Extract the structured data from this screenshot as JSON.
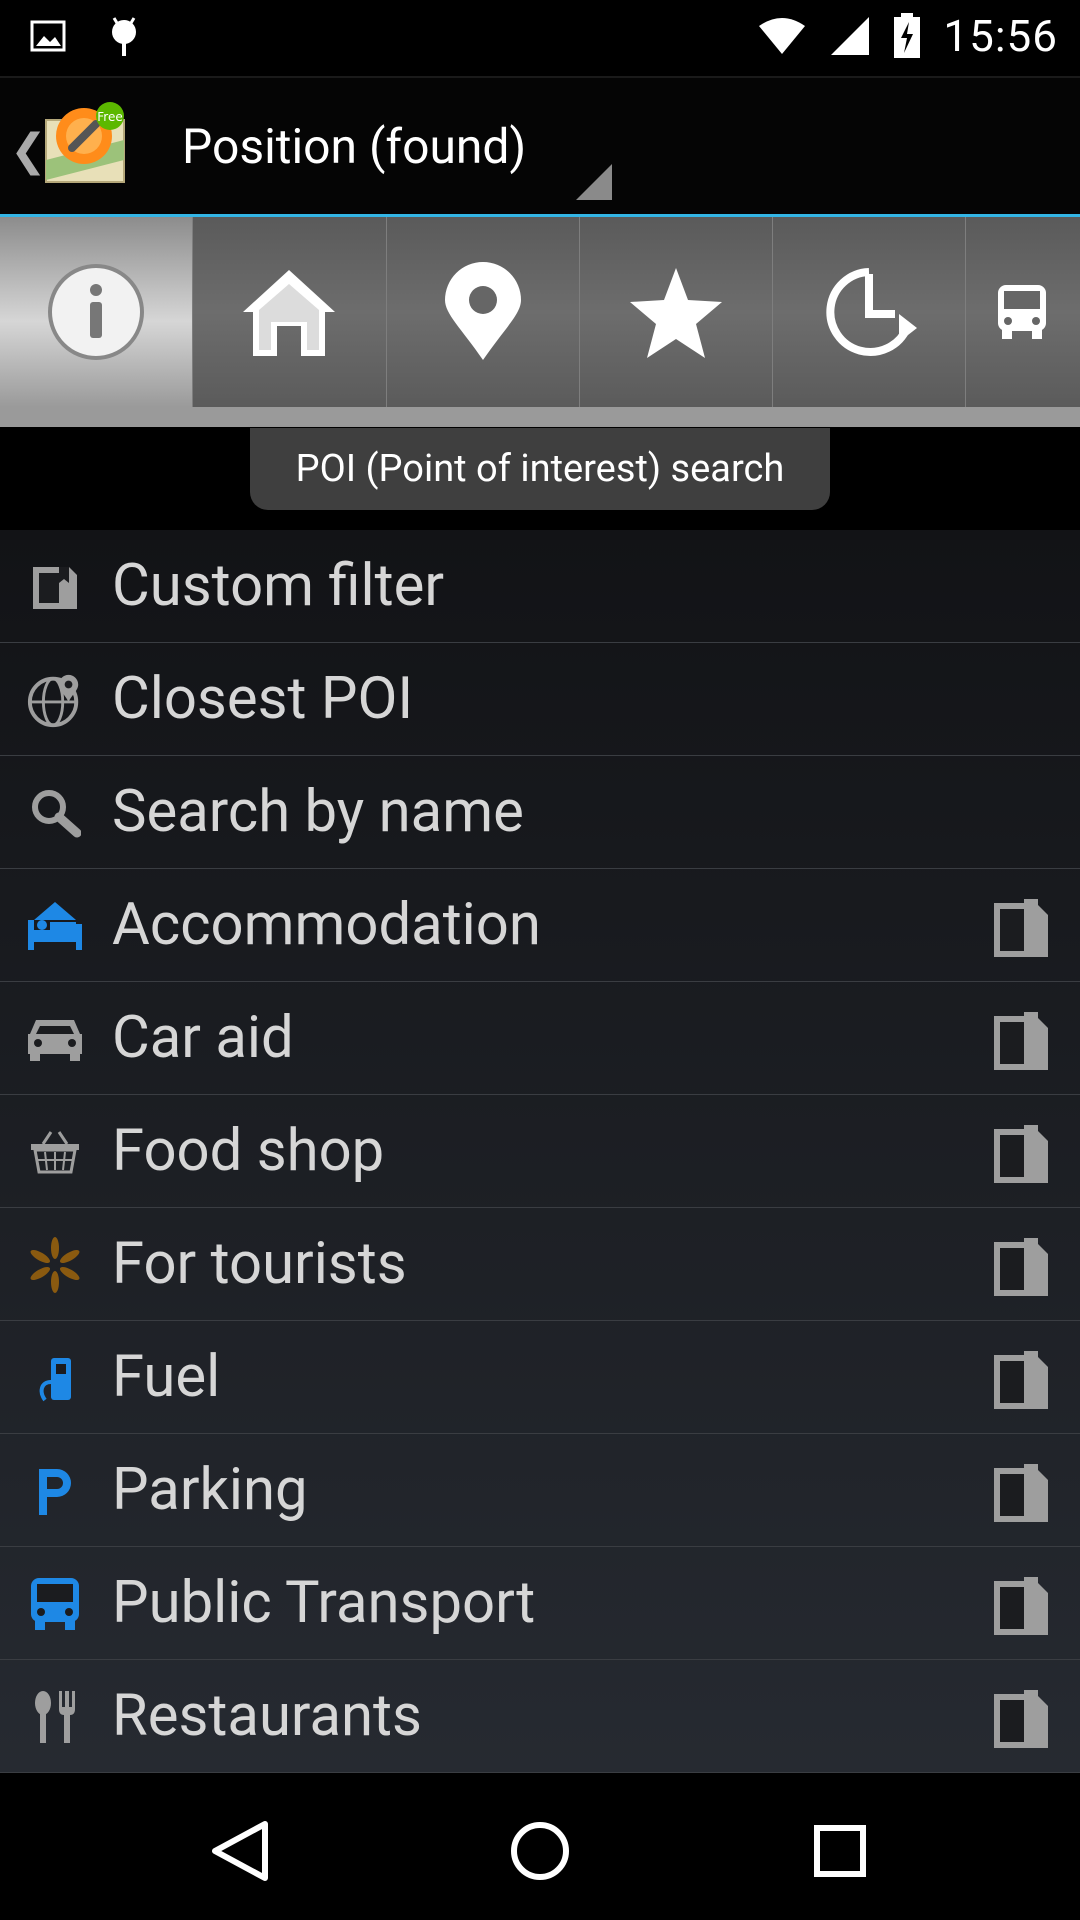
{
  "status_bar": {
    "time": "15:56"
  },
  "action_bar": {
    "title": "Position (found)",
    "logo_badge": "Free"
  },
  "toolbar": {
    "buttons": [
      {
        "icon": "info-icon",
        "active": true
      },
      {
        "icon": "home-icon",
        "active": false
      },
      {
        "icon": "map-pin-icon",
        "active": false
      },
      {
        "icon": "star-icon",
        "active": false
      },
      {
        "icon": "history-icon",
        "active": false
      },
      {
        "icon": "bus-icon",
        "active": false
      }
    ],
    "tooltip": "POI (Point of interest) search"
  },
  "list": {
    "items": [
      {
        "label": "Custom filter",
        "icon": "custom-filter-icon",
        "bookmark": false
      },
      {
        "label": "Closest POI",
        "icon": "globe-pin-icon",
        "bookmark": false
      },
      {
        "label": "Search by name",
        "icon": "search-icon",
        "bookmark": false
      },
      {
        "label": "Accommodation",
        "icon": "bed-icon",
        "bookmark": true
      },
      {
        "label": "Car aid",
        "icon": "car-icon",
        "bookmark": true
      },
      {
        "label": "Food shop",
        "icon": "basket-icon",
        "bookmark": true
      },
      {
        "label": "For tourists",
        "icon": "asterisk-icon",
        "bookmark": true
      },
      {
        "label": "Fuel",
        "icon": "fuel-icon",
        "bookmark": true
      },
      {
        "label": "Parking",
        "icon": "parking-icon",
        "bookmark": true
      },
      {
        "label": "Public Transport",
        "icon": "bus-icon",
        "bookmark": true
      },
      {
        "label": "Restaurants",
        "icon": "fork-spoon-icon",
        "bookmark": true
      }
    ]
  },
  "colors": {
    "accent": "#33b5e5",
    "icon_blue": "#1e88e5",
    "icon_gray": "#9e9e9e",
    "icon_orange": "#8a5a10"
  }
}
